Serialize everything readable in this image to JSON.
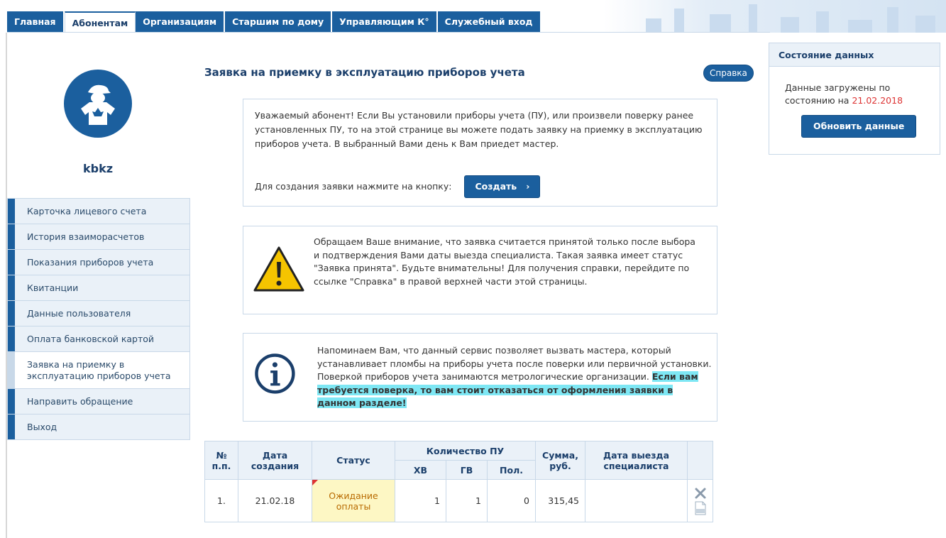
{
  "nav": {
    "tabs": [
      "Главная",
      "Абонентам",
      "Организациям",
      "Старшим по дому",
      "Управляющим К°",
      "Служебный вход"
    ],
    "active_index": 1
  },
  "profile": {
    "username": "kbkz"
  },
  "sidebar": {
    "items": [
      "Карточка лицевого счета",
      "История взаиморасчетов",
      "Показания приборов учета",
      "Квитанции",
      "Данные пользователя",
      "Оплата банковской картой",
      "Заявка на приемку в эксплуатацию приборов учета",
      "Направить обращение",
      "Выход"
    ],
    "active_index": 6
  },
  "main": {
    "title": "Заявка на приемку в эксплуатацию приборов учета",
    "help_label": "Справка",
    "intro_text": "Уважаемый абонент! Если Вы установили приборы учета (ПУ), или произвели поверку ранее установленных ПУ, то на этой странице вы можете подать заявку на приемку в эксплуатацию приборов учета. В выбранный Вами день к Вам приедет мастер.",
    "create_prompt": "Для создания заявки нажмите на кнопку:",
    "create_label": "Создать",
    "warning_text": "Обращаем Ваше внимание, что заявка считается принятой только после выбора и подтверждения Вами даты выезда специалиста. Такая заявка имеет статус \"Заявка принята\". Будьте внимательны! Для получения справки, перейдите по ссылке \"Справка\" в правой верхней части этой страницы.",
    "info_text": "Напоминаем Вам, что данный сервис позволяет вызвать мастера, который устанавливает пломбы на приборы учета после поверки или первичной установки. Поверкой приборов учета занимаются метрологические организации.",
    "info_highlight": "Если вам требуется поверка, то вам стоит отказаться от оформления заявки в данном разделе!"
  },
  "status_panel": {
    "title": "Состояние данных",
    "text": "Данные загружены по состоянию на",
    "date": "21.02.2018",
    "refresh_label": "Обновить данные"
  },
  "table": {
    "headers": {
      "num": "№ п.п.",
      "created": "Дата создания",
      "status": "Статус",
      "count_group": "Количество ПУ",
      "hv": "ХВ",
      "gv": "ГВ",
      "pol": "Пол.",
      "sum": "Сумма, руб.",
      "visit": "Дата выезда специалиста"
    },
    "rows": [
      {
        "num": "1.",
        "created": "21.02.18",
        "status": "Ожидание оплаты",
        "hv": "1",
        "gv": "1",
        "pol": "0",
        "sum": "315,45",
        "visit": ""
      }
    ]
  },
  "colors": {
    "primary": "#1b5f9e",
    "date_red": "#dd3333",
    "highlight": "#7ee7f4",
    "status_bg": "#fdf7c4"
  }
}
